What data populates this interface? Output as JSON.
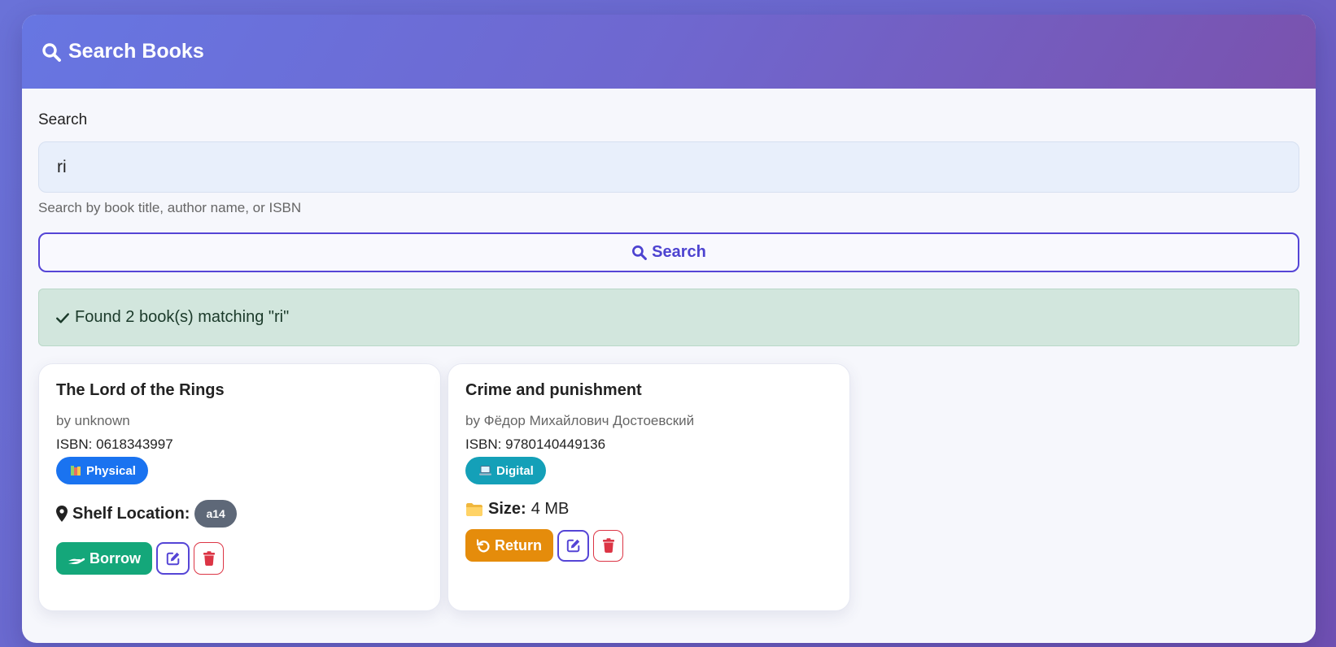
{
  "header": {
    "title": "Search Books",
    "icon": "search-icon"
  },
  "search": {
    "label": "Search",
    "value": "ri",
    "help": "Search by book title, author name, or ISBN",
    "button_label": "Search"
  },
  "alert": {
    "text": "Found 2 book(s) matching \"ri\"",
    "icon": "check-icon"
  },
  "books": [
    {
      "title": "The Lord of the Rings",
      "author": "by unknown",
      "isbn": "ISBN: 0618343997",
      "type_badge": "Physical",
      "detail_label": "Shelf Location:",
      "detail_value": "a14",
      "action_label": "Borrow"
    },
    {
      "title": "Crime and punishment",
      "author": "by Фёдор Михайлович Достоевский",
      "isbn": "ISBN: 9780140449136",
      "type_badge": "Digital",
      "detail_label": "Size:",
      "detail_value": "4 MB",
      "action_label": "Return"
    }
  ],
  "colors": {
    "accent": "#5545d6",
    "borrow": "#14a77a",
    "return": "#e58c0b",
    "physical_badge": "#1a73f0",
    "digital_badge": "#14a0b8",
    "delete": "#dc3545"
  }
}
